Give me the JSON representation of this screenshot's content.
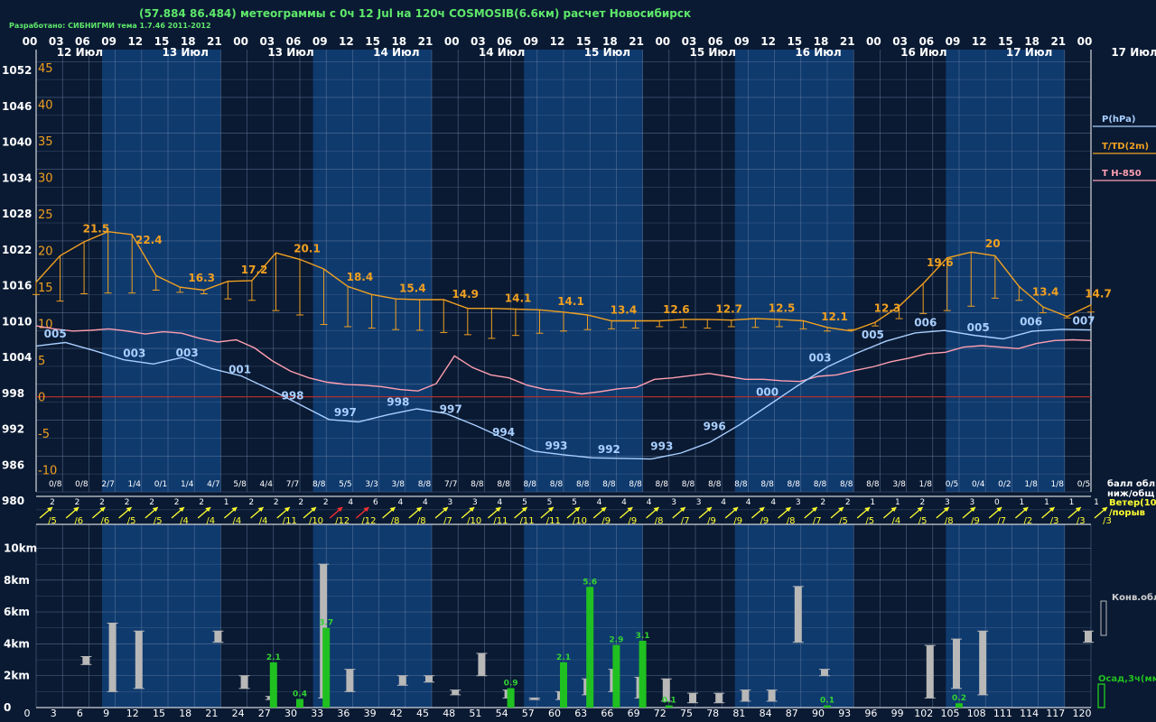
{
  "header": {
    "title": "(57.884 86.484) метеограммы с  0ч 12 Jul на 120ч COSMOSIB(6.6км) расчет Новосибирск",
    "credit": "Разработано: СИБНИГМИ тема 1.7.46 2011-2012"
  },
  "legend": {
    "pressure": "P(hPa)",
    "temperature": "T/TD(2m)",
    "t850": "T H-850",
    "clouds": "балл обл.\nниж/общ",
    "wind": "Ветер(10м)\n/порыв",
    "convective": "Конв.обл.",
    "precip": "Осад,3ч(мм)"
  },
  "colors": {
    "background": "#0a1a33",
    "band_light": "#0f3a6e",
    "band_dark": "#0a1a33",
    "grid": "#7088a8",
    "pressure": "#a9cfff",
    "temperature": "#f0a020",
    "t850": "#ff9fb0",
    "zero_line": "#c0302a",
    "wind_arrow": "#ffff30",
    "wind_strong": "#ff3030",
    "conv_bar": "#b8b8b8",
    "precip_bar": "#20c020"
  },
  "chart_data": {
    "type": "line",
    "hours_top": [
      "00",
      "03",
      "06",
      "09",
      "12",
      "15",
      "18",
      "21",
      "00",
      "03",
      "06",
      "09",
      "12",
      "15",
      "18",
      "21",
      "00",
      "03",
      "06",
      "09",
      "12",
      "15",
      "18",
      "21",
      "00",
      "03",
      "06",
      "09",
      "12",
      "15",
      "18",
      "21",
      "00",
      "03",
      "06",
      "09",
      "12",
      "15",
      "18",
      "21",
      "00"
    ],
    "day_labels": [
      "12 Июл",
      "13 Июл",
      "13 Июл",
      "14 Июл",
      "14 Июл",
      "15 Июл",
      "15 Июл",
      "16 Июл",
      "16 Июл",
      "17 Июл",
      "17 Июл"
    ],
    "lead_hours": [
      "0",
      "3",
      "6",
      "9",
      "12",
      "15",
      "18",
      "21",
      "24",
      "27",
      "30",
      "33",
      "36",
      "39",
      "42",
      "45",
      "48",
      "51",
      "54",
      "57",
      "60",
      "63",
      "66",
      "69",
      "72",
      "75",
      "78",
      "81",
      "84",
      "87",
      "90",
      "93",
      "96",
      "99",
      "102",
      "105",
      "108",
      "111",
      "114",
      "117",
      "120"
    ],
    "pressure_axis": [
      "1052",
      "1046",
      "1040",
      "1034",
      "1028",
      "1022",
      "1016",
      "1010",
      "1004",
      "998",
      "992",
      "986",
      "980"
    ],
    "pressure_range": [
      980,
      1054
    ],
    "temperature_axis": [
      "45",
      "40",
      "35",
      "30",
      "25",
      "20",
      "15",
      "10",
      "5",
      "0",
      "-5",
      "-10"
    ],
    "temperature_range": [
      -13,
      47.5
    ],
    "pressure": [
      1004.4,
      1005.0,
      1003.6,
      1002.1,
      1001.4,
      1002.5,
      1000.6,
      999.4,
      997.1,
      994.6,
      992.1,
      991.7,
      992.9,
      993.9,
      993.1,
      991.1,
      988.9,
      986.8,
      986.2,
      985.7,
      985.6,
      985.5,
      986.5,
      988.3,
      991.2,
      994.5,
      997.8,
      1000.9,
      1003.2,
      1005.2,
      1006.6,
      1007.0,
      1006.2,
      1005.6,
      1006.9,
      1007.2,
      1007.1
    ],
    "pressure_labels": [
      {
        "i": 1,
        "t": "005"
      },
      {
        "i": 4,
        "t": "003"
      },
      {
        "i": 6,
        "t": "003"
      },
      {
        "i": 8,
        "t": "001"
      },
      {
        "i": 10,
        "t": "998"
      },
      {
        "i": 12,
        "t": "997"
      },
      {
        "i": 14,
        "t": "998"
      },
      {
        "i": 16,
        "t": "997"
      },
      {
        "i": 18,
        "t": "994"
      },
      {
        "i": 20,
        "t": "993"
      },
      {
        "i": 22,
        "t": "992"
      },
      {
        "i": 24,
        "t": "993"
      },
      {
        "i": 26,
        "t": "996"
      },
      {
        "i": 28,
        "t": "000"
      },
      {
        "i": 30,
        "t": "003"
      },
      {
        "i": 32,
        "t": "005"
      },
      {
        "i": 34,
        "t": "006"
      },
      {
        "i": 36,
        "t": "005"
      },
      {
        "i": 38,
        "t": "006"
      },
      {
        "i": 40,
        "t": "007"
      }
    ],
    "temperature": [
      15.7,
      19.3,
      21.2,
      22.6,
      22.2,
      16.6,
      15.0,
      14.6,
      15.8,
      15.9,
      19.7,
      18.8,
      17.5,
      15.1,
      14.0,
      13.4,
      13.3,
      13.3,
      12.1,
      12.1,
      12.0,
      11.9,
      11.6,
      11.2,
      10.4,
      10.4,
      10.4,
      10.6,
      10.6,
      10.5,
      10.7,
      10.6,
      10.4,
      9.5,
      9.0,
      10.2,
      12.4,
      15.5,
      19.0,
      19.8,
      19.3,
      15.1,
      12.3,
      11.0,
      12.6
    ],
    "temperature_labels": [
      {
        "i": 2,
        "t": "21.5"
      },
      {
        "i": 4,
        "t": "22.4"
      },
      {
        "i": 6,
        "t": "16.3"
      },
      {
        "i": 8,
        "t": "17.2"
      },
      {
        "i": 10,
        "t": "20.1"
      },
      {
        "i": 12,
        "t": "18.4"
      },
      {
        "i": 14,
        "t": "15.4"
      },
      {
        "i": 16,
        "t": "14.9"
      },
      {
        "i": 18,
        "t": "14.1"
      },
      {
        "i": 20,
        "t": "14.1"
      },
      {
        "i": 22,
        "t": "13.4"
      },
      {
        "i": 24,
        "t": "12.6"
      },
      {
        "i": 26,
        "t": "12.7"
      },
      {
        "i": 28,
        "t": "12.5"
      },
      {
        "i": 30,
        "t": "12.1"
      },
      {
        "i": 32,
        "t": "12.3"
      },
      {
        "i": 34,
        "t": "19.6"
      },
      {
        "i": 36,
        "t": "20"
      },
      {
        "i": 38,
        "t": "13.4"
      },
      {
        "i": 40,
        "t": "14.7"
      }
    ],
    "dewpoint": [
      14.0,
      13.1,
      14.1,
      14.2,
      14.2,
      14.6,
      14.3,
      14.1,
      13.4,
      13.2,
      11.8,
      11.2,
      9.9,
      9.6,
      9.4,
      9.2,
      9.1,
      8.8,
      8.5,
      8.0,
      8.4,
      8.7,
      9.0,
      9.2,
      9.3,
      9.4,
      9.6,
      9.5,
      9.4,
      9.6,
      9.5,
      9.6,
      9.3,
      9.0,
      9.2,
      9.7,
      10.7,
      11.4,
      11.8,
      12.4,
      13.5,
      13.2,
      11.5,
      10.8,
      11.6
    ],
    "t850": [
      9.7,
      9.3,
      9.0,
      9.1,
      9.3,
      9.0,
      8.6,
      8.9,
      8.7,
      8.0,
      7.5,
      7.8,
      6.7,
      4.9,
      3.5,
      2.6,
      2.0,
      1.7,
      1.6,
      1.4,
      1.0,
      0.8,
      1.8,
      5.6,
      4.0,
      3.0,
      2.6,
      1.6,
      1.0,
      0.8,
      0.4,
      0.7,
      1.1,
      1.3,
      2.4,
      2.6,
      2.9,
      3.2,
      2.8,
      2.4,
      2.4,
      2.2,
      2.1,
      2.8,
      3.0,
      3.6,
      4.1,
      4.8,
      5.3,
      5.9,
      6.1,
      6.8,
      7.0,
      6.8,
      6.6,
      7.3,
      7.7,
      7.8,
      7.7
    ],
    "cloud_cover": [
      "0/8",
      "0/8",
      "2/7",
      "1/4",
      "0/1",
      "1/4",
      "4/7",
      "5/8",
      "4/4",
      "7/7",
      "8/8",
      "5/5",
      "3/3",
      "3/8",
      "8/8",
      "7/7",
      "8/8",
      "8/8",
      "8/8",
      "8/8",
      "8/8",
      "8/8",
      "8/8",
      "8/8",
      "8/8",
      "8/8",
      "8/8",
      "8/8",
      "8/8",
      "8/8",
      "8/8",
      "8/8",
      "3/8",
      "1/8",
      "0/5",
      "0/4",
      "0/2",
      "1/8",
      "1/8",
      "0/5"
    ],
    "wind_speed": [
      "2",
      "2",
      "2",
      "2",
      "2",
      "2",
      "2",
      "1",
      "2",
      "2",
      "2",
      "2",
      "4",
      "6",
      "4",
      "4",
      "3",
      "3",
      "4",
      "5",
      "5",
      "5",
      "4",
      "4",
      "4",
      "3",
      "3",
      "4",
      "4",
      "4",
      "3",
      "2",
      "2",
      "1",
      "1",
      "2",
      "3",
      "3",
      "0",
      "1",
      "1",
      "1",
      "1"
    ],
    "wind_gust": [
      "/5",
      "/6",
      "/6",
      "/5",
      "/5",
      "/4",
      "/4",
      "/4",
      "/4",
      "/11",
      "/10",
      "/12",
      "/12",
      "/8",
      "/8",
      "/7",
      "/10",
      "/11",
      "/11",
      "/11",
      "/10",
      "/9",
      "/9",
      "/8",
      "/7",
      "/9",
      "/9",
      "/9",
      "/8",
      "/7",
      "/5",
      "/5",
      "/4",
      "/5",
      "/8",
      "/9",
      "/7",
      "/2",
      "/3",
      "/3",
      "/3"
    ],
    "height_axis": [
      "10km",
      "8km",
      "6km",
      "4km",
      "2km",
      "0"
    ],
    "height_range_km": [
      0,
      11.5
    ],
    "convective_cloud_km": [
      {
        "h": 6,
        "base": 2.7,
        "top": 3.2
      },
      {
        "h": 9,
        "base": 1.0,
        "top": 5.3
      },
      {
        "h": 12,
        "base": 1.2,
        "top": 4.8
      },
      {
        "h": 21,
        "base": 4.1,
        "top": 4.8
      },
      {
        "h": 24,
        "base": 1.2,
        "top": 2.0
      },
      {
        "h": 27,
        "base": 0.5,
        "top": 0.7
      },
      {
        "h": 33,
        "base": 0.6,
        "top": 9.0
      },
      {
        "h": 36,
        "base": 1.0,
        "top": 2.4
      },
      {
        "h": 42,
        "base": 1.4,
        "top": 2.0
      },
      {
        "h": 45,
        "base": 1.6,
        "top": 2.0
      },
      {
        "h": 48,
        "base": 0.8,
        "top": 1.1
      },
      {
        "h": 51,
        "base": 2.0,
        "top": 3.4
      },
      {
        "h": 54,
        "base": 0.6,
        "top": 1.1
      },
      {
        "h": 57,
        "base": 0.5,
        "top": 0.6
      },
      {
        "h": 60,
        "base": 0.5,
        "top": 1.0
      },
      {
        "h": 63,
        "base": 0.8,
        "top": 1.8
      },
      {
        "h": 66,
        "base": 1.0,
        "top": 2.4
      },
      {
        "h": 69,
        "base": 0.6,
        "top": 1.9
      },
      {
        "h": 72,
        "base": 0.4,
        "top": 1.8
      },
      {
        "h": 75,
        "base": 0.3,
        "top": 0.9
      },
      {
        "h": 78,
        "base": 0.3,
        "top": 0.9
      },
      {
        "h": 81,
        "base": 0.4,
        "top": 1.1
      },
      {
        "h": 84,
        "base": 0.4,
        "top": 1.1
      },
      {
        "h": 87,
        "base": 4.1,
        "top": 7.6
      },
      {
        "h": 90,
        "base": 2.0,
        "top": 2.4
      },
      {
        "h": 102,
        "base": 0.6,
        "top": 3.9
      },
      {
        "h": 105,
        "base": 1.2,
        "top": 4.3
      },
      {
        "h": 108,
        "base": 0.8,
        "top": 4.8
      },
      {
        "h": 120,
        "base": 4.1,
        "top": 4.8
      }
    ],
    "precip_3h_mm": [
      {
        "h": 27,
        "v": 2.1
      },
      {
        "h": 30,
        "v": 0.4
      },
      {
        "h": 33,
        "v": 3.7
      },
      {
        "h": 54,
        "v": 0.9
      },
      {
        "h": 60,
        "v": 2.1
      },
      {
        "h": 63,
        "v": 5.6
      },
      {
        "h": 66,
        "v": 2.9
      },
      {
        "h": 69,
        "v": 3.1
      },
      {
        "h": 72,
        "v": 0.1
      },
      {
        "h": 90,
        "v": 0.1
      },
      {
        "h": 105,
        "v": 0.2
      }
    ],
    "precip_range_mm": [
      0,
      8.5
    ],
    "grid": true
  }
}
